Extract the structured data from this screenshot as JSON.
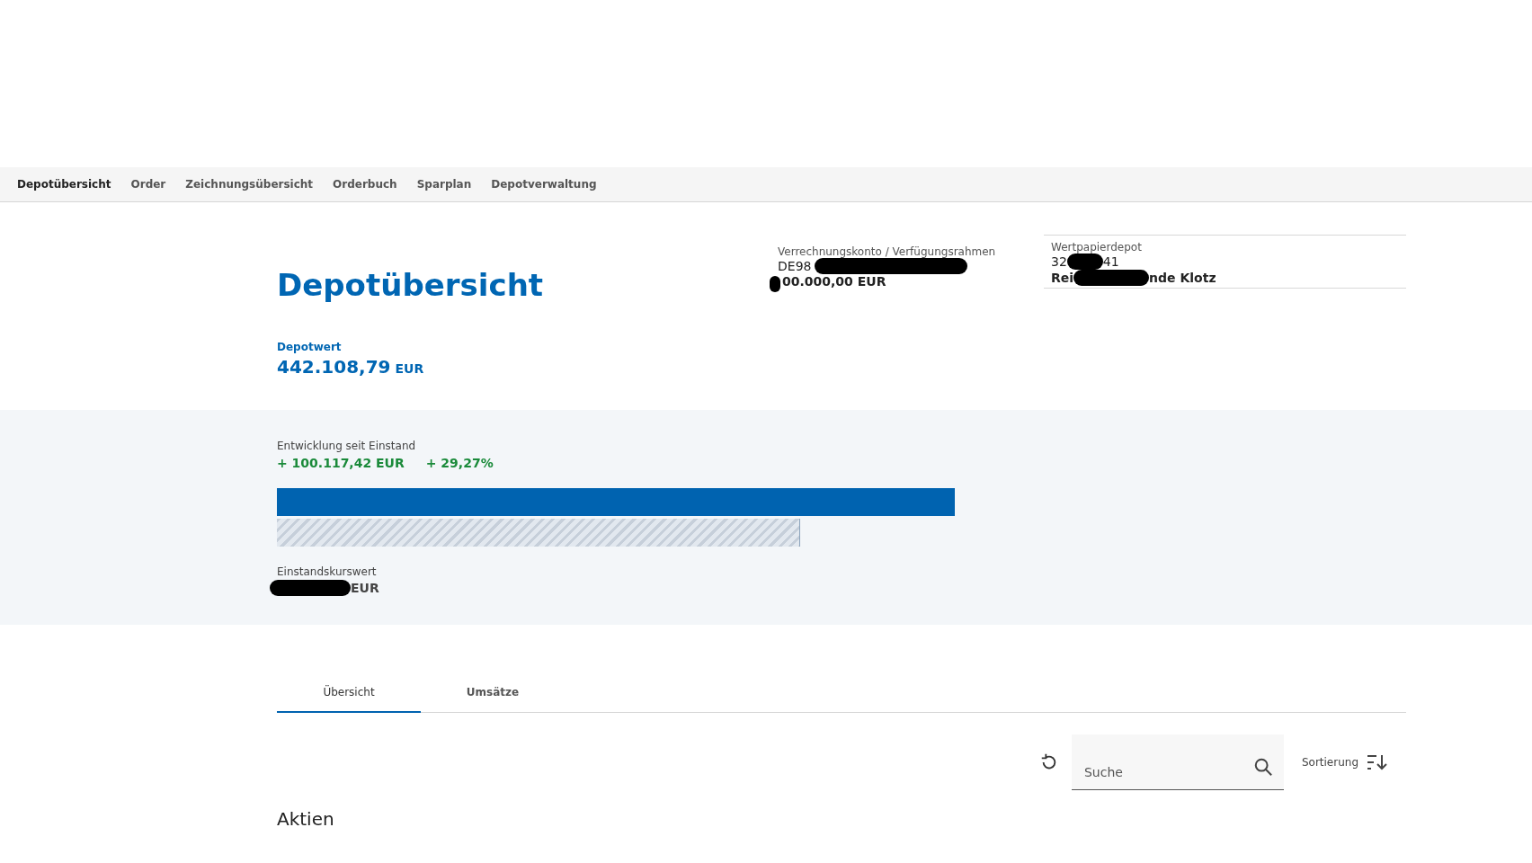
{
  "nav": {
    "items": [
      {
        "label": "Depotübersicht",
        "selected": true
      },
      {
        "label": "Order",
        "selected": false
      },
      {
        "label": "Zeichnungsübersicht",
        "selected": false
      },
      {
        "label": "Orderbuch",
        "selected": false
      },
      {
        "label": "Sparplan",
        "selected": false
      },
      {
        "label": "Depotverwaltung",
        "selected": false
      }
    ]
  },
  "header": {
    "title": "Depotübersicht",
    "clearing_account": {
      "label": "Verrechnungskonto / Verfügungsrahmen",
      "number_prefix": "DE98",
      "limit": "00.000,00 EUR"
    },
    "securities_depot": {
      "label": "Wertpapierdepot",
      "number_start": "32",
      "number_end": "41",
      "owner_start": "Rei",
      "owner_end": "nde Klotz"
    }
  },
  "depot_value": {
    "label": "Depotwert",
    "amount": "442.108,79",
    "currency": "EUR"
  },
  "development": {
    "label": "Entwicklung seit Einstand",
    "amount": "+ 100.117,42 EUR",
    "percent": "+ 29,27%",
    "bars": [
      {
        "kind": "current"
      },
      {
        "kind": "cost"
      }
    ],
    "cost_label": "Einstandskurswert",
    "cost_currency": "EUR"
  },
  "tabs": [
    {
      "label": "Übersicht",
      "selected": true
    },
    {
      "label": "Umsätze",
      "selected": false
    }
  ],
  "toolbar": {
    "search": {
      "placeholder": "Suche"
    },
    "sort_label": "Sortierung"
  },
  "section_title": "Aktien"
}
